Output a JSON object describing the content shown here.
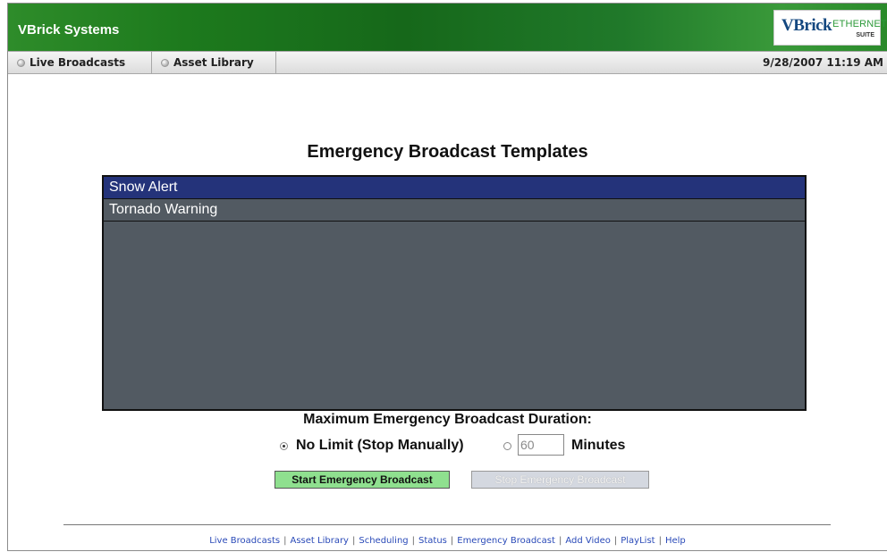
{
  "header": {
    "app_title": "VBrick Systems",
    "logo_main": "VBrick",
    "logo_sub": "ETHERNETV",
    "logo_suite": "SUITE"
  },
  "nav": {
    "tabs": [
      {
        "label": "Live Broadcasts",
        "icon": "radio-dot-icon"
      },
      {
        "label": "Asset Library",
        "icon": "radio-dot-icon"
      }
    ],
    "datetime": "9/28/2007 11:19 AM"
  },
  "main": {
    "heading": "Emergency Broadcast Templates",
    "templates": [
      {
        "label": "Snow Alert",
        "selected": true
      },
      {
        "label": "Tornado Warning",
        "selected": false
      }
    ],
    "duration_label": "Maximum Emergency Broadcast Duration:",
    "option_no_limit": "No Limit (Stop Manually)",
    "option_no_limit_selected": true,
    "minutes_value": "60",
    "minutes_label": "Minutes",
    "start_button": "Start Emergency Broadcast",
    "stop_button": "Stop Emergency Broadcast"
  },
  "footer": {
    "links": [
      "Live Broadcasts",
      "Asset Library",
      "Scheduling",
      "Status",
      "Emergency Broadcast",
      "Add Video",
      "PlayList",
      "Help"
    ],
    "separator": "|"
  },
  "colors": {
    "header_green": "#1d7a1d",
    "selected_item": "#24337a",
    "listbox_bg": "#525a62",
    "start_button_bg": "#8fe08f",
    "link_blue": "#2a4ab8"
  }
}
